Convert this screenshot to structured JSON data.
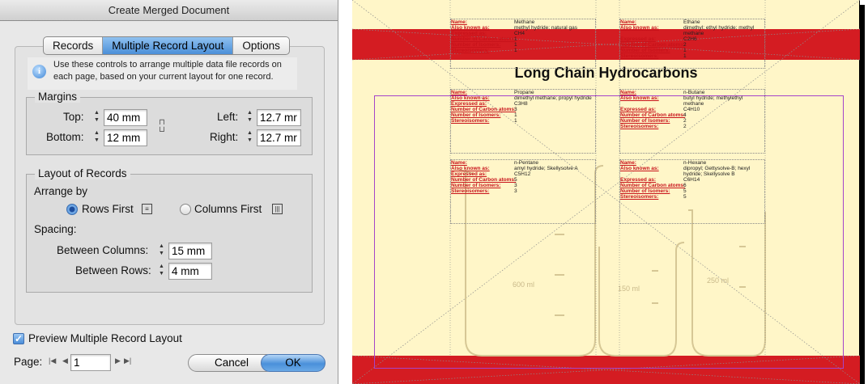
{
  "dialog": {
    "title": "Create Merged Document",
    "tabs": [
      "Records",
      "Multiple Record Layout",
      "Options"
    ],
    "active_tab": 1,
    "info_text": "Use these controls to arrange multiple data file records on each page, based on your current layout for one record.",
    "margins": {
      "title": "Margins",
      "top_label": "Top:",
      "top_value": "40 mm",
      "bottom_label": "Bottom:",
      "bottom_value": "12 mm",
      "left_label": "Left:",
      "left_value": "12.7 mr",
      "right_label": "Right:",
      "right_value": "12.7 mr"
    },
    "layout": {
      "title": "Layout of Records",
      "arrange_by": "Arrange by",
      "rows_first": "Rows First",
      "columns_first": "Columns First",
      "selected": "rows_first",
      "spacing": "Spacing:",
      "between_columns_label": "Between Columns:",
      "between_columns_value": "15 mm",
      "between_rows_label": "Between Rows:",
      "between_rows_value": "4 mm"
    },
    "preview_label": "Preview Multiple Record Layout",
    "preview_checked": true,
    "page_label": "Page:",
    "page_value": "1",
    "cancel": "Cancel",
    "ok": "OK"
  },
  "preview": {
    "heading": "Long Chain Hydrocarbons",
    "band_color": "#d41c22",
    "page_color": "#fff6c8",
    "field_labels": {
      "name": "Name:",
      "aka": "Also known as:",
      "expressed": "Expressed as:",
      "carbon": "Number of Carbon atoms:",
      "isomers": "Number of Isomers:",
      "stereo": "Stereoisomers:"
    },
    "records": [
      {
        "name": "Methane",
        "aka": "methyl hydride; natural gas",
        "expressed": "CH4",
        "carbon": "1",
        "isomers": "1",
        "stereo": "1"
      },
      {
        "name": "Ethane",
        "aka": "dimethyl; ethyl hydride; methyl methane",
        "expressed": "C2H6",
        "carbon": "2",
        "isomers": "1",
        "stereo": "1"
      },
      {
        "name": "Propane",
        "aka": "dimethyl methane; propyl hydride",
        "expressed": "C3H8",
        "carbon": "3",
        "isomers": "1",
        "stereo": "1"
      },
      {
        "name": "n-Butane",
        "aka": "butyl hydride; methylethyl methane",
        "expressed": "C4H10",
        "carbon": "4",
        "isomers": "2",
        "stereo": "2"
      },
      {
        "name": "n-Pentane",
        "aka": "amyl hydride; Skellysolve A",
        "expressed": "C5H12",
        "carbon": "5",
        "isomers": "3",
        "stereo": "3"
      },
      {
        "name": "n-Hexane",
        "aka": "dipropyl; Gettysolve-B; hexyl hydride; Skellysolve B",
        "expressed": "C6H14",
        "carbon": "6",
        "isomers": "5",
        "stereo": "5"
      }
    ],
    "beakers": [
      "600 ml",
      "150 ml",
      "250 ml"
    ]
  }
}
